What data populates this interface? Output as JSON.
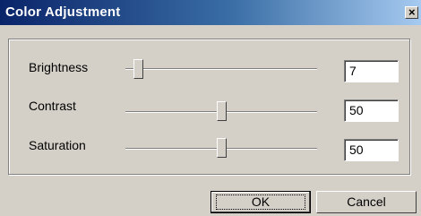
{
  "window": {
    "title": "Color Adjustment",
    "close_glyph": "×"
  },
  "sliders": [
    {
      "label": "Brightness",
      "value": "7",
      "level": 0.07
    },
    {
      "label": "Contrast",
      "value": "50",
      "level": 0.5
    },
    {
      "label": "Saturation",
      "value": "50",
      "level": 0.5
    }
  ],
  "buttons": {
    "ok_label": "OK",
    "cancel_label": "Cancel"
  }
}
